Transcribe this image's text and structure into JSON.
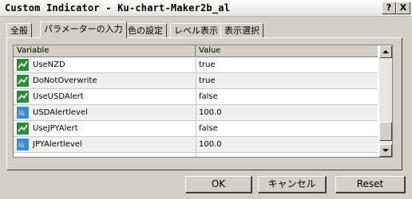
{
  "window": {
    "title": "Custom Indicator - Ku-chart-Maker2b_al",
    "help_label": "?",
    "close_label": "X"
  },
  "tabs": [
    {
      "label": "全般"
    },
    {
      "label": "パラメーターの入力"
    },
    {
      "label": "色の設定"
    },
    {
      "label": "レベル表示"
    },
    {
      "label": "表示選択"
    }
  ],
  "table": {
    "columns": [
      "Variable",
      "Value"
    ],
    "rows": [
      {
        "name": "UseNZD",
        "value": "true",
        "icon": "bool-icon"
      },
      {
        "name": "DoNotOverwrite",
        "value": "true",
        "icon": "bool-icon"
      },
      {
        "name": "UseUSDAlert",
        "value": "false",
        "icon": "bool-icon"
      },
      {
        "name": "USDAlertlevel",
        "value": "100.0",
        "icon": "value-icon"
      },
      {
        "name": "UseJPYAlert",
        "value": "false",
        "icon": "bool-icon"
      },
      {
        "name": "JPYAlertlevel",
        "value": "100.0",
        "icon": "value-icon"
      }
    ]
  },
  "buttons": {
    "ok": "OK",
    "cancel": "キャンセル",
    "reset": "Reset"
  },
  "colors": {
    "dialog_bg": "#d4d0c8",
    "bool_icon": "#2e8b3a",
    "value_icon": "#3a8ecb"
  }
}
